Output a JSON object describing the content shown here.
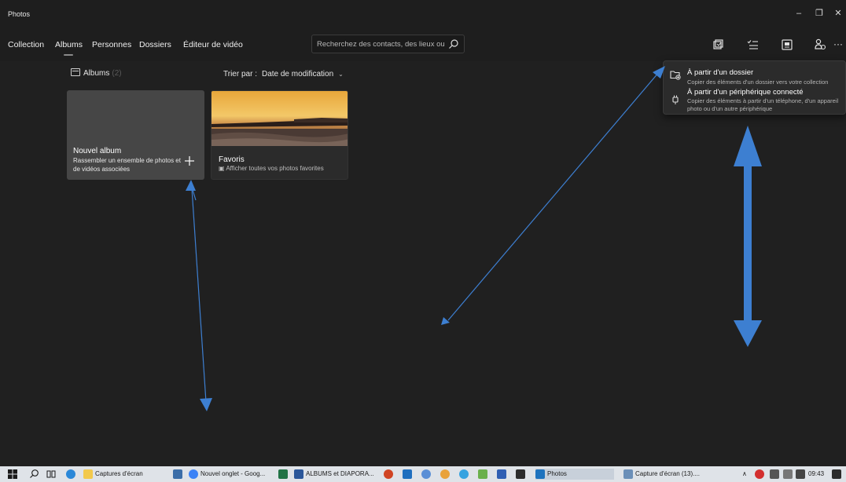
{
  "window": {
    "title": "Photos",
    "controls": {
      "minimize": "–",
      "maximize": "❐",
      "close": "✕"
    }
  },
  "nav": {
    "tabs": [
      {
        "label": "Collection"
      },
      {
        "label": "Albums",
        "selected": true
      },
      {
        "label": "Personnes"
      },
      {
        "label": "Dossiers"
      },
      {
        "label": "Éditeur de vidéo"
      }
    ],
    "search_placeholder": "Recherchez des contacts, des lieux ou",
    "toolbar_icons": [
      "import-icon",
      "select-icon",
      "slideshow-icon",
      "people-icon",
      "more-icon"
    ],
    "more_label": "···"
  },
  "content": {
    "section_label": "Albums",
    "section_count": "(2)",
    "sort_label": "Trier par :",
    "sort_value": "Date de modification",
    "sort_chevron": "⌄",
    "cards": {
      "new_album": {
        "title": "Nouvel album",
        "description": "Rassembler un ensemble de photos et de vidéos associées"
      },
      "favorites": {
        "title": "Favoris",
        "subtitle": "Afficher toutes vos photos favorites"
      }
    }
  },
  "import_menu": {
    "items": [
      {
        "title": "À partir d'un dossier",
        "description": "Copier des éléments d'un dossier vers votre collection"
      },
      {
        "title": "À partir d'un périphérique connecté",
        "description": "Copier des éléments à partir d'un téléphone, d'un appareil photo ou d'un autre périphérique"
      }
    ]
  },
  "taskbar": {
    "apps": [
      {
        "label": "Captures d'écran",
        "color": "#f2c94c"
      },
      {
        "label": "Nouvel onglet - Goog...",
        "color": "#3b82f6"
      },
      {
        "label": "ALBUMS et DIAPORA...",
        "color": "#2b579a"
      },
      {
        "label": "Photos",
        "color": "#1e73be"
      },
      {
        "label": "Capture d'écran (13)....",
        "color": "#6b8fb8"
      }
    ],
    "clock": "09:43",
    "tray_glyphs": "∧"
  },
  "colors": {
    "accent_arrow": "#3d7fd1",
    "background": "#202020"
  }
}
